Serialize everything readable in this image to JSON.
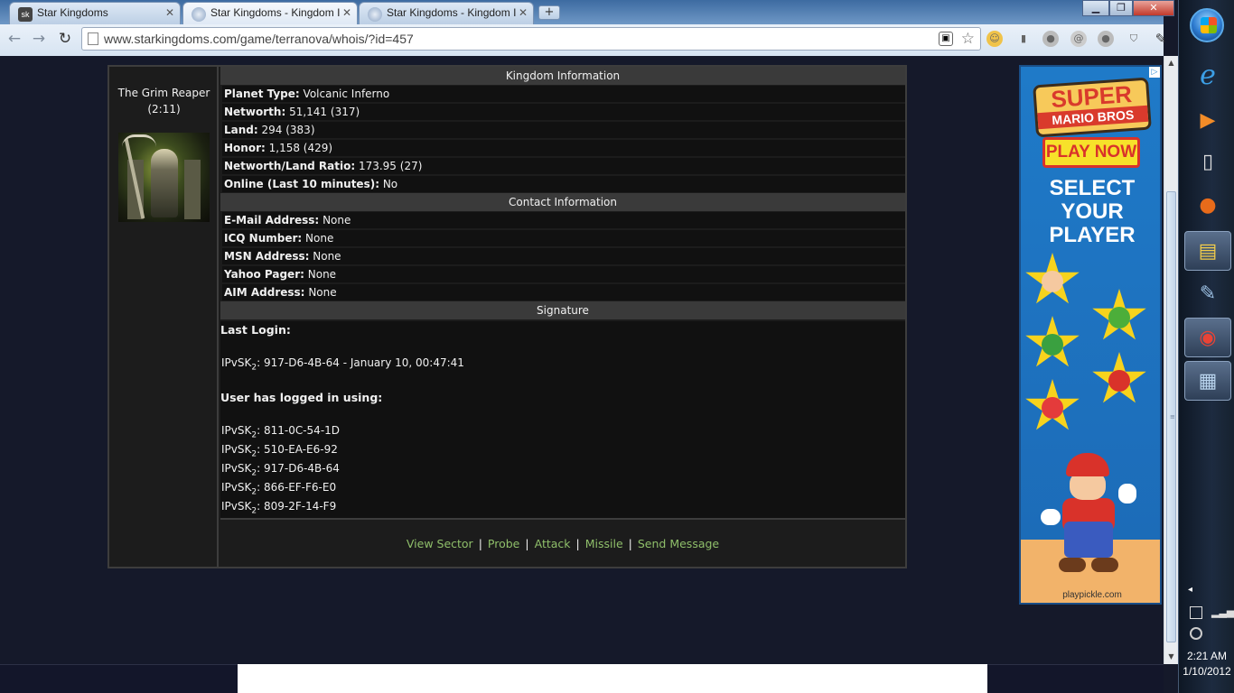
{
  "browser": {
    "tabs": [
      {
        "title": "Star Kingdoms",
        "fav": "sk-favicon",
        "active": false
      },
      {
        "title": "Star Kingdoms - Kingdom I",
        "fav": "globe-favicon",
        "active": true
      },
      {
        "title": "Star Kingdoms - Kingdom I",
        "fav": "globe-favicon",
        "active": false
      }
    ],
    "new_tab_label": "+",
    "url": "www.starkingdoms.com/game/terranova/whois/?id=457",
    "back_icon": "back-arrow-icon",
    "forward_icon": "forward-arrow-icon",
    "reload_icon": "reload-icon",
    "star_icon": "bookmark-star-icon",
    "wrench_icon": "wrench-icon"
  },
  "player": {
    "name": "The Grim Reaper",
    "coords": "(2:11)"
  },
  "kingdom": {
    "header": "Kingdom Information",
    "rows": [
      {
        "label": "Planet Type:",
        "value": "Volcanic Inferno"
      },
      {
        "label": "Networth:",
        "value": "51,141 (317)"
      },
      {
        "label": "Land:",
        "value": "294 (383)"
      },
      {
        "label": "Honor:",
        "value": "1,158 (429)"
      },
      {
        "label": "Networth/Land Ratio:",
        "value": "173.95 (27)"
      },
      {
        "label": "Online (Last 10 minutes):",
        "value": "No"
      }
    ]
  },
  "contact": {
    "header": "Contact Information",
    "rows": [
      {
        "label": "E-Mail Address:",
        "value": "None"
      },
      {
        "label": "ICQ Number:",
        "value": "None"
      },
      {
        "label": "MSN Address:",
        "value": "None"
      },
      {
        "label": "Yahoo Pager:",
        "value": "None"
      },
      {
        "label": "AIM Address:",
        "value": "None"
      }
    ]
  },
  "signature": {
    "header": "Signature",
    "last_login_label": "Last Login:",
    "ip_prefix": "IPvSK",
    "ip_sub": "2",
    "last_login": ": 917-D6-4B-64 - January 10, 00:47:41",
    "logged_in_label": "User has logged in using:",
    "ips": [
      ": 811-0C-54-1D",
      ": 510-EA-E6-92",
      ": 917-D6-4B-64",
      ": 866-EF-F6-E0",
      ": 809-2F-14-F9"
    ]
  },
  "actions": [
    "View Sector",
    "Probe",
    "Attack",
    "Missile",
    "Send Message"
  ],
  "actions_separator": "|",
  "ad": {
    "logo_line1": "SUPER",
    "logo_line2": "MARIO BROS",
    "play": "PLAY NOW",
    "select": "SELECT YOUR PLAYER",
    "url": "playpickle.com"
  },
  "taskbar": {
    "time": "2:21 AM",
    "date": "1/10/2012"
  }
}
